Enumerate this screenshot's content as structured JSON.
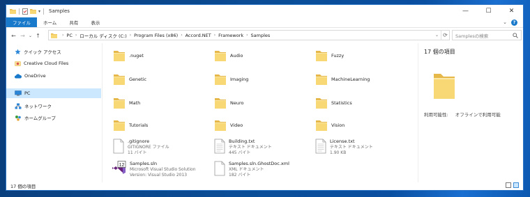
{
  "titlebar": {
    "title": "Samples",
    "buttons": {
      "minimize": "—",
      "maximize": "☐",
      "close": "✕"
    }
  },
  "ribbon": {
    "tabs": [
      "ファイル",
      "ホーム",
      "共有",
      "表示"
    ],
    "expand_glyph": "⌄",
    "help_glyph": "?"
  },
  "address": {
    "back": "←",
    "forward": "→",
    "recent": "⌄",
    "up": "↑",
    "crumbs": [
      "PC",
      "ローカル ディスク (C:)",
      "Program Files (x86)",
      "Accord.NET",
      "Framework",
      "Samples"
    ],
    "separator": "›",
    "dropdown": "⌄",
    "refresh": "⟳"
  },
  "search": {
    "placeholder": "Samplesの検索",
    "icon": "search-icon"
  },
  "nav": {
    "items": [
      {
        "label": "クイック アクセス",
        "icon": "star-icon",
        "selected": false
      },
      {
        "label": "Creative Cloud Files",
        "icon": "cloud-icon",
        "selected": false
      },
      {
        "label": "OneDrive",
        "icon": "onedrive-icon",
        "selected": false
      },
      {
        "label": "PC",
        "icon": "pc-icon",
        "selected": true
      },
      {
        "label": "ネットワーク",
        "icon": "network-icon",
        "selected": false
      },
      {
        "label": "ホームグループ",
        "icon": "homegroup-icon",
        "selected": false
      }
    ]
  },
  "items": {
    "folders": [
      ".nuget",
      "Audio",
      "Fuzzy",
      "Genetic",
      "Imaging",
      "MachineLearning",
      "Math",
      "Neuro",
      "Statistics",
      "Tutorials",
      "Video",
      "Vision"
    ],
    "files": [
      {
        "name": ".gitignore",
        "type": "GITIGNORE ファイル",
        "size": "11 バイト"
      },
      {
        "name": "Building.txt",
        "type": "テキスト ドキュメント",
        "size": "445 バイト"
      },
      {
        "name": "License.txt",
        "type": "テキスト ドキュメント",
        "size": "1.90 KB"
      },
      {
        "name": "Samples.sln",
        "type": "Microsoft Visual Studio Solution",
        "size": "Version: Visual Studio 2013",
        "icon_text": "12"
      },
      {
        "name": "Samples.sln.GhostDoc.xml",
        "type": "XML ドキュメント",
        "size": "182 バイト"
      }
    ]
  },
  "preview": {
    "title": "17 個の項目",
    "availability_label": "利用可能性:",
    "availability_value": "オフラインで利用可能"
  },
  "status": {
    "count": "17 個の項目"
  },
  "colors": {
    "accent": "#1979ca",
    "selection": "#cce8ff",
    "folder": "#f8d775",
    "folder_dark": "#e6b84a"
  }
}
